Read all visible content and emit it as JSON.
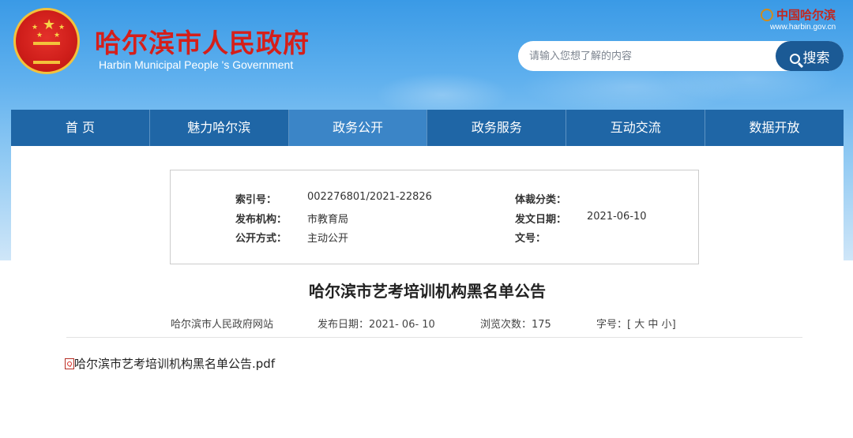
{
  "header": {
    "title_cn": "哈尔滨市人民政府",
    "title_en": "Harbin Municipal People 's Government",
    "logo_text": "中国哈尔滨",
    "logo_url": "www.harbin.gov.cn",
    "search": {
      "placeholder": "请输入您想了解的内容",
      "button_label": "搜索"
    }
  },
  "nav": {
    "items": [
      "首 页",
      "魅力哈尔滨",
      "政务公开",
      "政务服务",
      "互动交流",
      "数据开放"
    ],
    "active_index": 2
  },
  "meta": {
    "index_label": "索引号：",
    "index_value": "002276801/2021-22826",
    "genre_label": "体裁分类：",
    "genre_value": "",
    "publisher_label": "发布机构：",
    "publisher_value": "市教育局",
    "date_label": "发文日期：",
    "date_value": "2021-06-10",
    "disclosure_label": "公开方式：",
    "disclosure_value": "主动公开",
    "doc_no_label": "文号：",
    "doc_no_value": ""
  },
  "article": {
    "title": "哈尔滨市艺考培训机构黑名单公告",
    "source": "哈尔滨市人民政府网站",
    "publish_date_label": "发布日期：",
    "publish_date": "2021- 06- 10",
    "views_label": "浏览次数：",
    "views": "175",
    "font_size_label": "字号：",
    "font_size_open": "[",
    "font_size_large": "大",
    "font_size_medium": "中",
    "font_size_small": "小",
    "font_size_close": "]",
    "attachment": "哈尔滨市艺考培训机构黑名单公告.pdf"
  },
  "colors": {
    "nav_bg": "#1f66a6",
    "nav_active": "#3b85c7",
    "title_red": "#d51f1a",
    "search_button": "#1b5a95"
  }
}
